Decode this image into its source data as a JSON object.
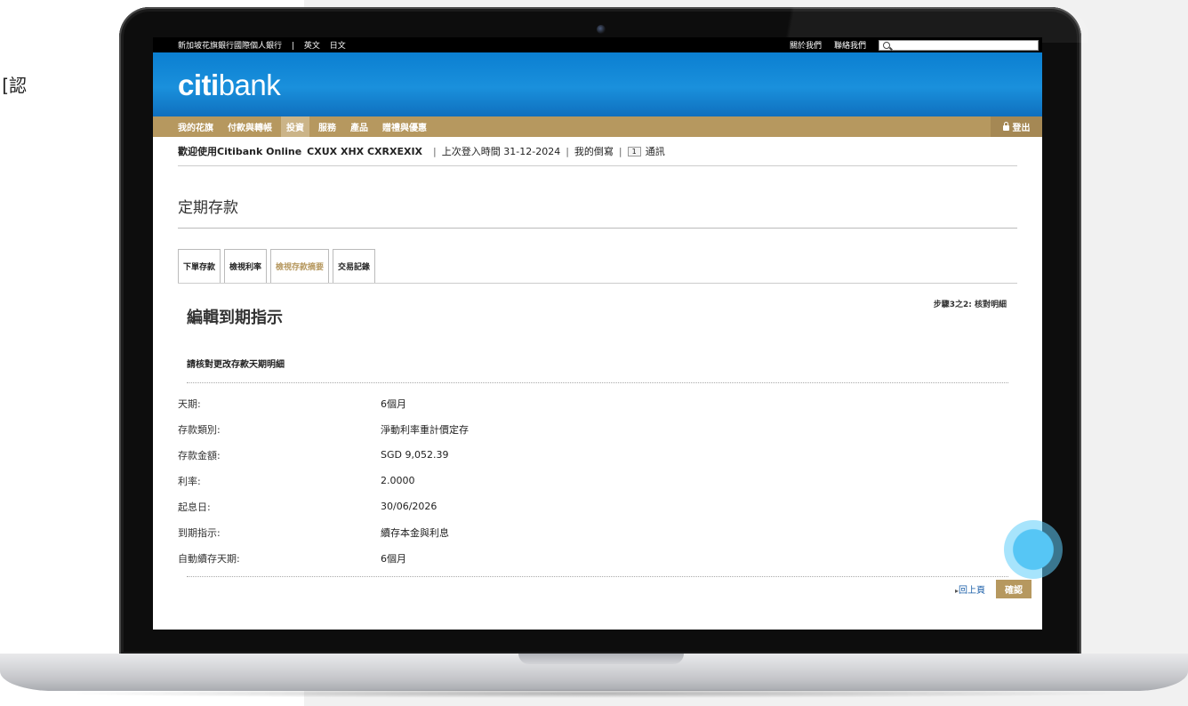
{
  "side_text": "認]",
  "topbar": {
    "site_name": "新加坡花旗銀行國際個人銀行",
    "sep": "|",
    "lang_en": "英文",
    "lang_jp": "日文",
    "about": "關於我們",
    "contact": "聯絡我們"
  },
  "brand": {
    "logo_citi": "citi",
    "logo_bank": "bank"
  },
  "nav": {
    "items": [
      "我的花旗",
      "付款與轉帳",
      "投資",
      "服務",
      "產品",
      "贈禮與優惠"
    ],
    "logout": "登出"
  },
  "welcome": {
    "greeting": "歡迎使用Citibank Online",
    "name": "CXUX XHX CXRXEXIX",
    "last_login": "上次登入時間 31-12-2024",
    "mailbox": "我的倒寫",
    "msg_count": "1",
    "messages": "通訊"
  },
  "page": {
    "title": "定期存款"
  },
  "tabs": [
    "下單存款",
    "檢視利率",
    "檢視存款摘要",
    "交易記錄"
  ],
  "form": {
    "step": "步驟3之2: 核對明細",
    "section_title": "編輯到期指示",
    "sub_title": "請核對更改存款天期明細",
    "rows": [
      {
        "label": "天期:",
        "value": "6個月"
      },
      {
        "label": "存款類別:",
        "value": "淨動利率重計價定存"
      },
      {
        "label": "存款金額:",
        "value": "SGD 9,052.39"
      },
      {
        "label": "利率:",
        "value": "2.0000"
      },
      {
        "label": "起息日:",
        "value": "30/06/2026"
      },
      {
        "label": "到期指示:",
        "value": "續存本金與利息"
      },
      {
        "label": "自動續存天期:",
        "value": "6個月"
      }
    ],
    "back": "回上頁",
    "confirm": "確認"
  }
}
